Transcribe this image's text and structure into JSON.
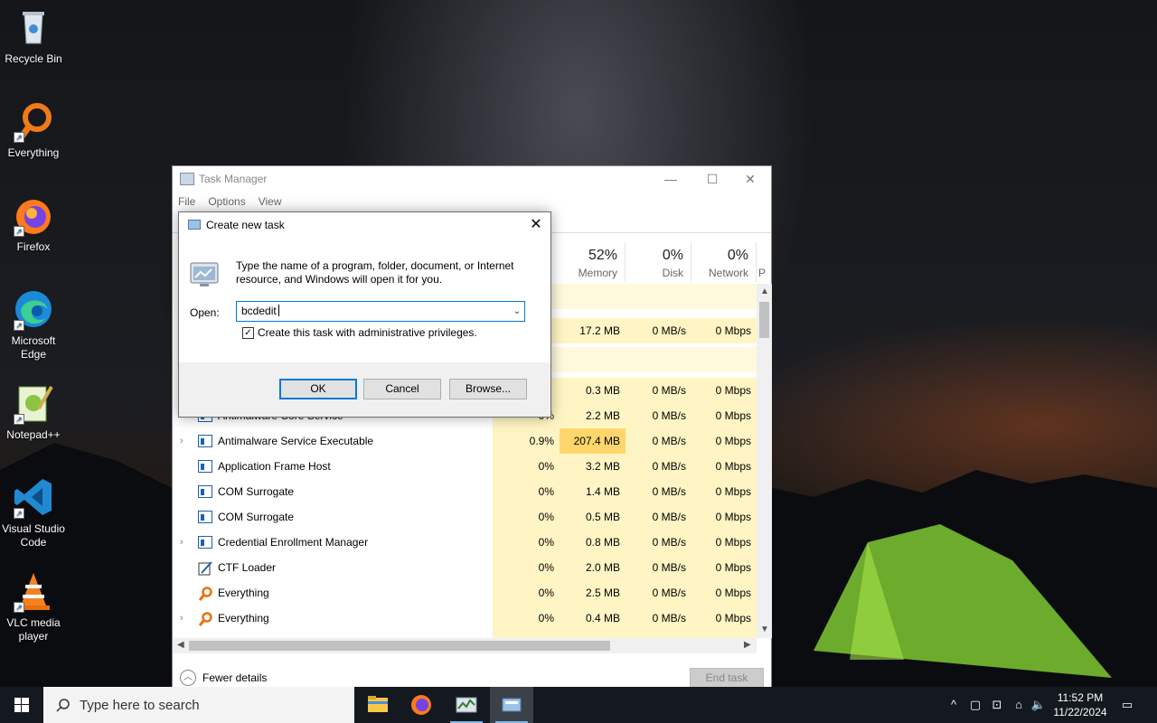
{
  "desktop": {
    "icons": [
      {
        "label": "Recycle Bin"
      },
      {
        "label": "Everything"
      },
      {
        "label": "Firefox"
      },
      {
        "label": "Microsoft Edge"
      },
      {
        "label": "Notepad++"
      },
      {
        "label": "Visual Studio Code"
      },
      {
        "label": "VLC media player"
      }
    ]
  },
  "task_manager": {
    "title": "Task Manager",
    "menu": [
      "File",
      "Options",
      "View"
    ],
    "columns": {
      "memory": {
        "pct": "52%",
        "label": "Memory"
      },
      "disk": {
        "pct": "0%",
        "label": "Disk"
      },
      "network": {
        "pct": "0%",
        "label": "Network"
      },
      "partial": "P"
    },
    "rows": [
      {
        "name": "",
        "cpu": "",
        "memory": "",
        "disk": "",
        "network": ""
      },
      {
        "name": "",
        "cpu": "",
        "memory": "17.2 MB",
        "disk": "0 MB/s",
        "network": "0 Mbps"
      },
      {
        "name": "",
        "cpu": "",
        "memory": "",
        "disk": "",
        "network": ""
      },
      {
        "name": "",
        "cpu": "",
        "memory": "0.3 MB",
        "disk": "0 MB/s",
        "network": "0 Mbps"
      },
      {
        "name": "Antimalware Core Service",
        "cpu": "0%",
        "memory": "2.2 MB",
        "disk": "0 MB/s",
        "network": "0 Mbps"
      },
      {
        "name": "Antimalware Service Executable",
        "cpu": "0.9%",
        "memory": "207.4 MB",
        "disk": "0 MB/s",
        "network": "0 Mbps"
      },
      {
        "name": "Application Frame Host",
        "cpu": "0%",
        "memory": "3.2 MB",
        "disk": "0 MB/s",
        "network": "0 Mbps"
      },
      {
        "name": "COM Surrogate",
        "cpu": "0%",
        "memory": "1.4 MB",
        "disk": "0 MB/s",
        "network": "0 Mbps"
      },
      {
        "name": "COM Surrogate",
        "cpu": "0%",
        "memory": "0.5 MB",
        "disk": "0 MB/s",
        "network": "0 Mbps"
      },
      {
        "name": "Credential Enrollment Manager",
        "cpu": "0%",
        "memory": "0.8 MB",
        "disk": "0 MB/s",
        "network": "0 Mbps"
      },
      {
        "name": "CTF Loader",
        "cpu": "0%",
        "memory": "2.0 MB",
        "disk": "0 MB/s",
        "network": "0 Mbps"
      },
      {
        "name": "Everything",
        "cpu": "0%",
        "memory": "2.5 MB",
        "disk": "0 MB/s",
        "network": "0 Mbps"
      },
      {
        "name": "Everything",
        "cpu": "0%",
        "memory": "0.4 MB",
        "disk": "0 MB/s",
        "network": "0 Mbps"
      }
    ],
    "fewer_details": "Fewer details",
    "end_task": "End task"
  },
  "run_dialog": {
    "title": "Create new task",
    "description": "Type the name of a program, folder, document, or Internet resource, and Windows will open it for you.",
    "open_label": "Open:",
    "open_value": "bcdedit",
    "admin_label": "Create this task with administrative privileges.",
    "admin_checked": true,
    "ok": "OK",
    "cancel": "Cancel",
    "browse": "Browse..."
  },
  "taskbar": {
    "search_placeholder": "Type here to search",
    "time": "11:52 PM",
    "date": "11/22/2024"
  },
  "colors": {
    "accent": "#0078d7",
    "heat_light": "#fff5c4",
    "heat_dark": "#ffd66b",
    "taskbar": "#14181f"
  }
}
